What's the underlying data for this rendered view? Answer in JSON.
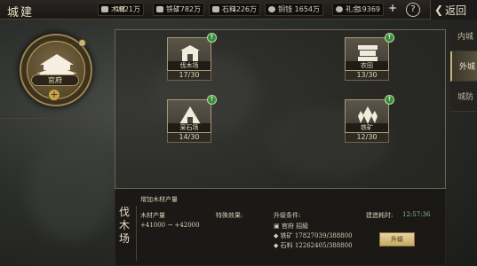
{
  "header": {
    "title": "城建",
    "back_label": "返回",
    "help": "?",
    "plus": "+"
  },
  "resources": [
    {
      "label": "木材",
      "value": "1821万",
      "icon": "wood-icon"
    },
    {
      "label": "铁矿",
      "value": "1782万",
      "icon": "iron-icon"
    },
    {
      "label": "石料",
      "value": "1226万",
      "icon": "stone-icon"
    },
    {
      "label": "铜钱",
      "value": "1654万",
      "icon": "coin-icon"
    },
    {
      "label": "礼金",
      "value": "19369",
      "icon": "gift-icon"
    }
  ],
  "emblem": {
    "name": "官府"
  },
  "tabs": [
    "内城",
    "外城",
    "城防"
  ],
  "active_tab": "外城",
  "buildings": [
    {
      "name": "伐木场",
      "count": "17/30",
      "icon": "lumber-mill-icon"
    },
    {
      "name": "农田",
      "count": "13/30",
      "icon": "farm-icon"
    },
    {
      "name": "采石场",
      "count": "14/30",
      "icon": "quarry-icon"
    },
    {
      "name": "铁矿",
      "count": "12/30",
      "icon": "iron-mine-icon"
    }
  ],
  "info": {
    "name": "伐木场",
    "desc": "增加木材产量",
    "output_label": "木材产量",
    "output_change": "+41000 → +42000",
    "special_label": "特殊效果:",
    "cond_label": "升级条件:",
    "cond_req": "官府 招級",
    "cond_iron": "铁矿 17827039/388800",
    "cond_stone": "石料 12262405/388800",
    "time_label": "建造耗时:",
    "time_value": "12:57:36",
    "upgrade_label": "升级"
  },
  "colors": {
    "accent": "#c9b47a",
    "badge_green": "#3c8a3a"
  }
}
